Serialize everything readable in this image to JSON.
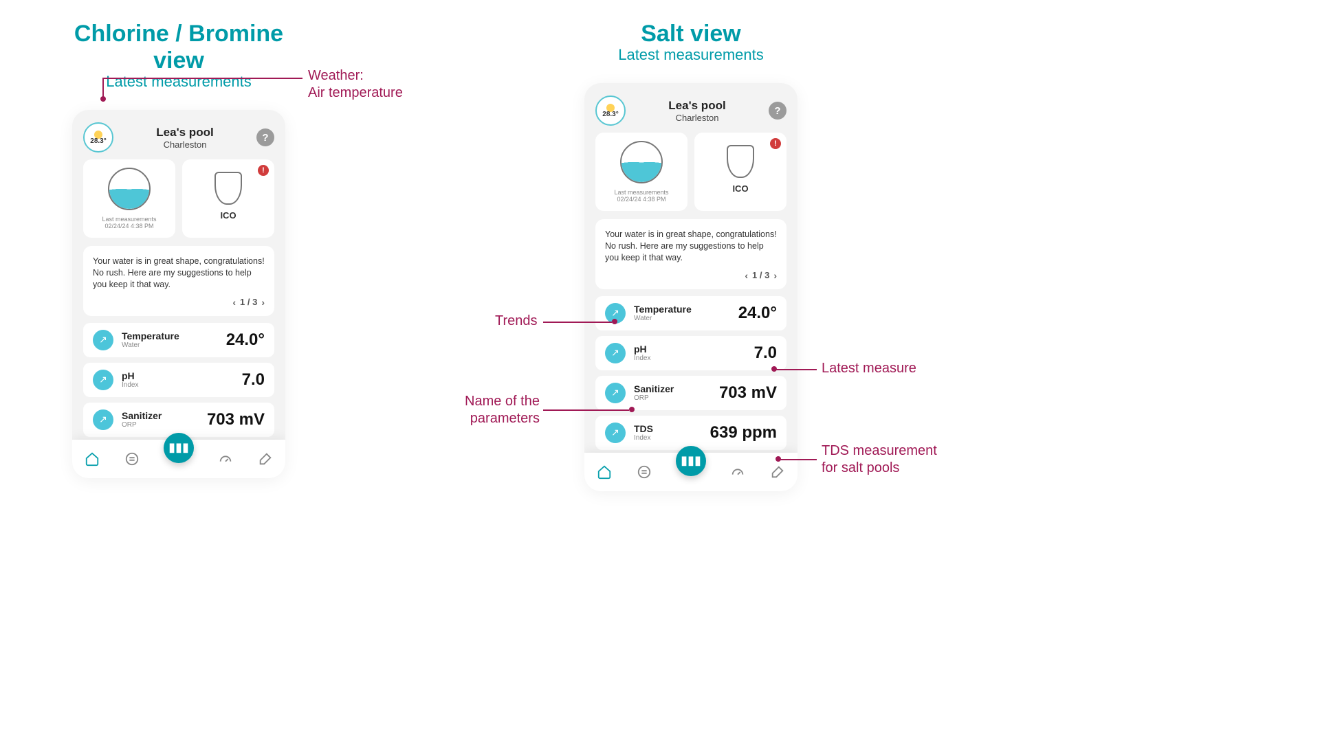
{
  "views": {
    "chlorine": {
      "title": "Chlorine / Bromine view",
      "subtitle": "Latest measurements"
    },
    "salt": {
      "title": "Salt view",
      "subtitle": "Latest measurements"
    }
  },
  "weather_temp": "28.3°",
  "pool": {
    "name": "Lea's pool",
    "location": "Charleston"
  },
  "help_label": "?",
  "cards": {
    "last": {
      "top_label": "Last measurements",
      "timestamp": "02/24/24 4:38 PM"
    },
    "ico": {
      "label": "ICO",
      "alert": "!"
    }
  },
  "advice_text": "Your water is in great shape, congratulations! No rush. Here are my suggestions to help you keep it that way.",
  "pager": "1 / 3",
  "measures": {
    "temperature": {
      "name": "Temperature",
      "sub": "Water",
      "value": "24.0°"
    },
    "ph": {
      "name": "pH",
      "sub": "Index",
      "value": "7.0"
    },
    "sanitizer": {
      "name": "Sanitizer",
      "sub": "ORP",
      "value": "703 mV"
    },
    "tds": {
      "name": "TDS",
      "sub": "Index",
      "value": "639 ppm"
    }
  },
  "annotations": {
    "weather": "Weather:\nAir temperature",
    "trends": "Trends",
    "param_name": "Name of the\nparameters",
    "latest_measure": "Latest measure",
    "tds": "TDS measurement\nfor salt pools"
  }
}
